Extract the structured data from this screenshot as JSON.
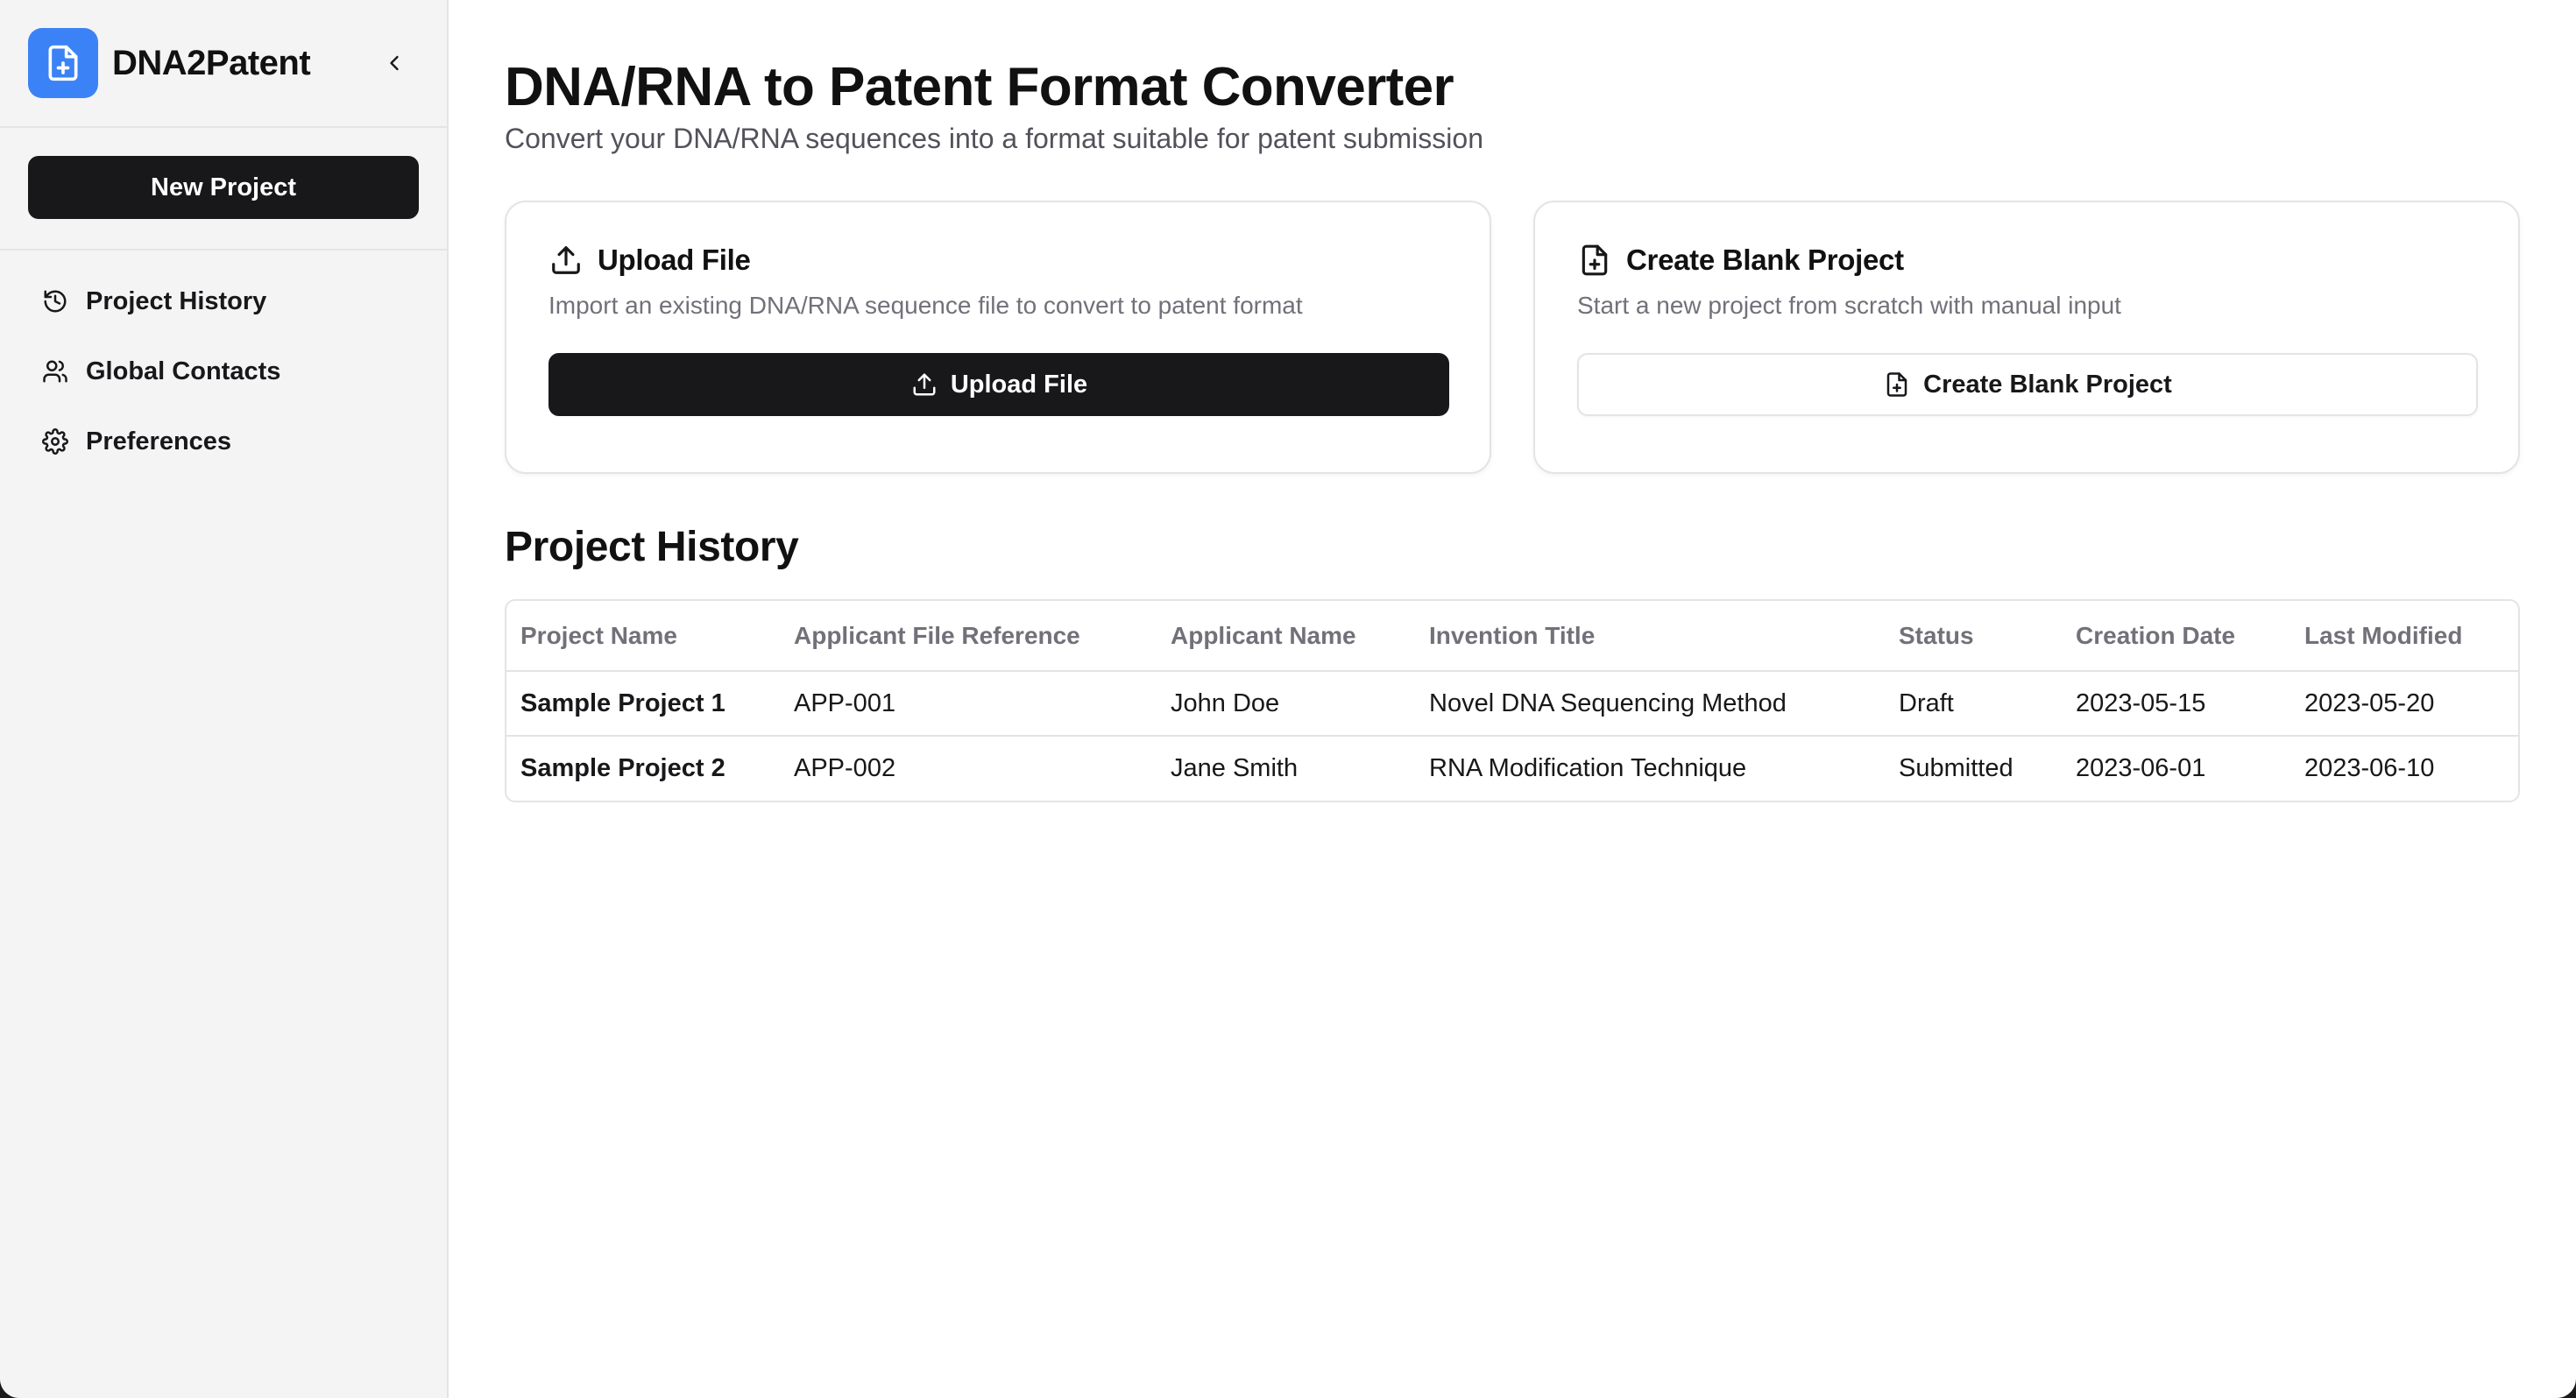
{
  "app": {
    "brand_name": "DNA2Patent",
    "brand_color": "#3b82f6"
  },
  "sidebar": {
    "new_project_label": "New Project",
    "items": [
      {
        "label": "Project History",
        "icon": "history-icon"
      },
      {
        "label": "Global Contacts",
        "icon": "users-icon"
      },
      {
        "label": "Preferences",
        "icon": "gear-icon"
      }
    ]
  },
  "main": {
    "title": "DNA/RNA to Patent Format Converter",
    "subtitle": "Convert your DNA/RNA sequences into a format suitable for patent submission",
    "cards": [
      {
        "title": "Upload File",
        "description": "Import an existing DNA/RNA sequence file to convert to patent format",
        "button_label": "Upload File",
        "icon": "upload-icon"
      },
      {
        "title": "Create Blank Project",
        "description": "Start a new project from scratch with manual input",
        "button_label": "Create Blank Project",
        "icon": "file-plus-icon"
      }
    ],
    "history": {
      "title": "Project History",
      "columns": [
        "Project Name",
        "Applicant File Reference",
        "Applicant Name",
        "Invention Title",
        "Status",
        "Creation Date",
        "Last Modified"
      ],
      "rows": [
        [
          "Sample Project 1",
          "APP-001",
          "John Doe",
          "Novel DNA Sequencing Method",
          "Draft",
          "2023-05-15",
          "2023-05-20"
        ],
        [
          "Sample Project 2",
          "APP-002",
          "Jane Smith",
          "RNA Modification Technique",
          "Submitted",
          "2023-06-01",
          "2023-06-10"
        ]
      ]
    }
  }
}
